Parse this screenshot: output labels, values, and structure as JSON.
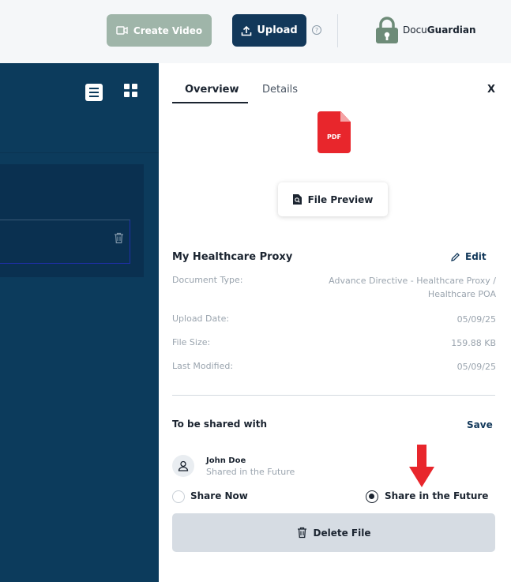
{
  "header": {
    "create_video_label": "Create Video",
    "upload_label": "Upload",
    "help_glyph": "?",
    "brand_prefix": "Docu",
    "brand_bold": "Guardian"
  },
  "left_panel": {
    "icons": [
      "list-view-icon",
      "grid-view-icon",
      "trash-icon"
    ]
  },
  "tabs": [
    {
      "label": "Overview",
      "active": true
    },
    {
      "label": "Details",
      "active": false
    }
  ],
  "close_label": "X",
  "file": {
    "icon_label": "PDF",
    "preview_label": "File Preview",
    "title": "My Healthcare Proxy",
    "edit_label": "Edit",
    "meta": [
      {
        "label": "Document Type:",
        "value": "Advance Directive - Healthcare Proxy /",
        "value2": "Healthcare POA"
      },
      {
        "label": "Upload Date:",
        "value": "05/09/25"
      },
      {
        "label": "File Size:",
        "value": "159.88 KB"
      },
      {
        "label": "Last Modified:",
        "value": "05/09/25"
      }
    ]
  },
  "sharing": {
    "title": "To be shared with",
    "save_label": "Save",
    "user_name": "John Doe",
    "user_status": "Shared in the Future",
    "options": [
      {
        "label": "Share Now",
        "selected": false
      },
      {
        "label": "Share in the Future",
        "selected": true
      }
    ]
  },
  "delete_label": "Delete File",
  "colors": {
    "navy": "#12385a",
    "sidebar": "#0c3b5c",
    "pdf_red": "#e8262c",
    "create_video_bg": "#9fb5a9",
    "annotation_arrow": "#e8262c"
  }
}
